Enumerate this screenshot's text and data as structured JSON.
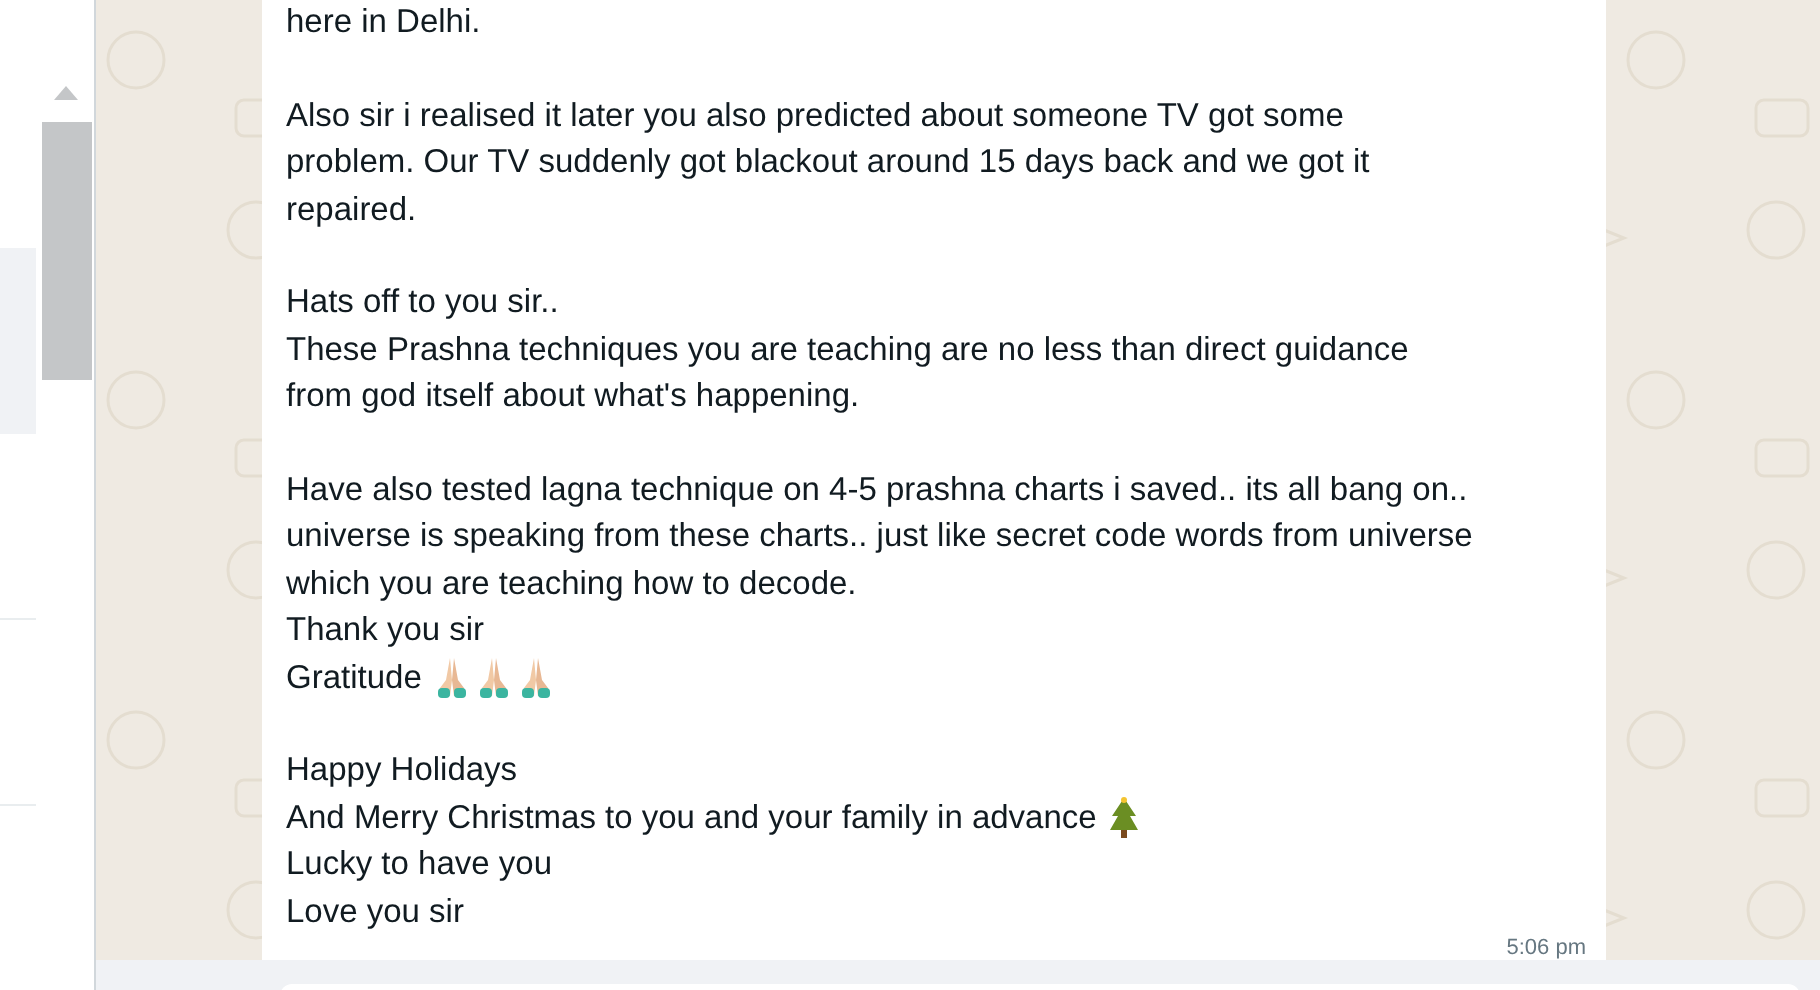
{
  "message": {
    "paragraphs": [
      [
        {
          "text": "here in Delhi.",
          "kind": "plain"
        }
      ],
      [
        {
          "text": "Also sir i realised it later you also predicted about someone TV got some",
          "kind": "plain"
        },
        {
          "text": "problem. Our TV suddenly got blackout around 15 days back and we got it",
          "kind": "plain"
        },
        {
          "text": "repaired.",
          "kind": "plain"
        }
      ],
      [
        {
          "text": "Hats off to you sir..",
          "kind": "plain"
        },
        {
          "text": "These Prashna techniques you are teaching are no less than direct guidance",
          "kind": "plain"
        },
        {
          "text": "from god itself about what's happening.",
          "kind": "plain"
        }
      ],
      [
        {
          "text": "Have also tested lagna technique on 4-5 prashna charts i saved.. its all bang on..",
          "kind": "plain"
        },
        {
          "text": "universe is speaking from these charts.. just like secret code words from universe",
          "kind": "plain"
        },
        {
          "text": "which you are teaching how to decode.",
          "kind": "plain"
        },
        {
          "text": "Thank you sir",
          "kind": "plain"
        },
        {
          "text": "Gratitude",
          "kind": "prayer"
        }
      ],
      [
        {
          "text": "Happy Holidays",
          "kind": "plain"
        },
        {
          "text": "And Merry Christmas to you and your family in advance",
          "kind": "tree"
        },
        {
          "text": "Lucky to have you",
          "kind": "plain"
        },
        {
          "text": "Love you sir",
          "kind": "plain"
        }
      ]
    ],
    "time": "5:06 pm"
  }
}
